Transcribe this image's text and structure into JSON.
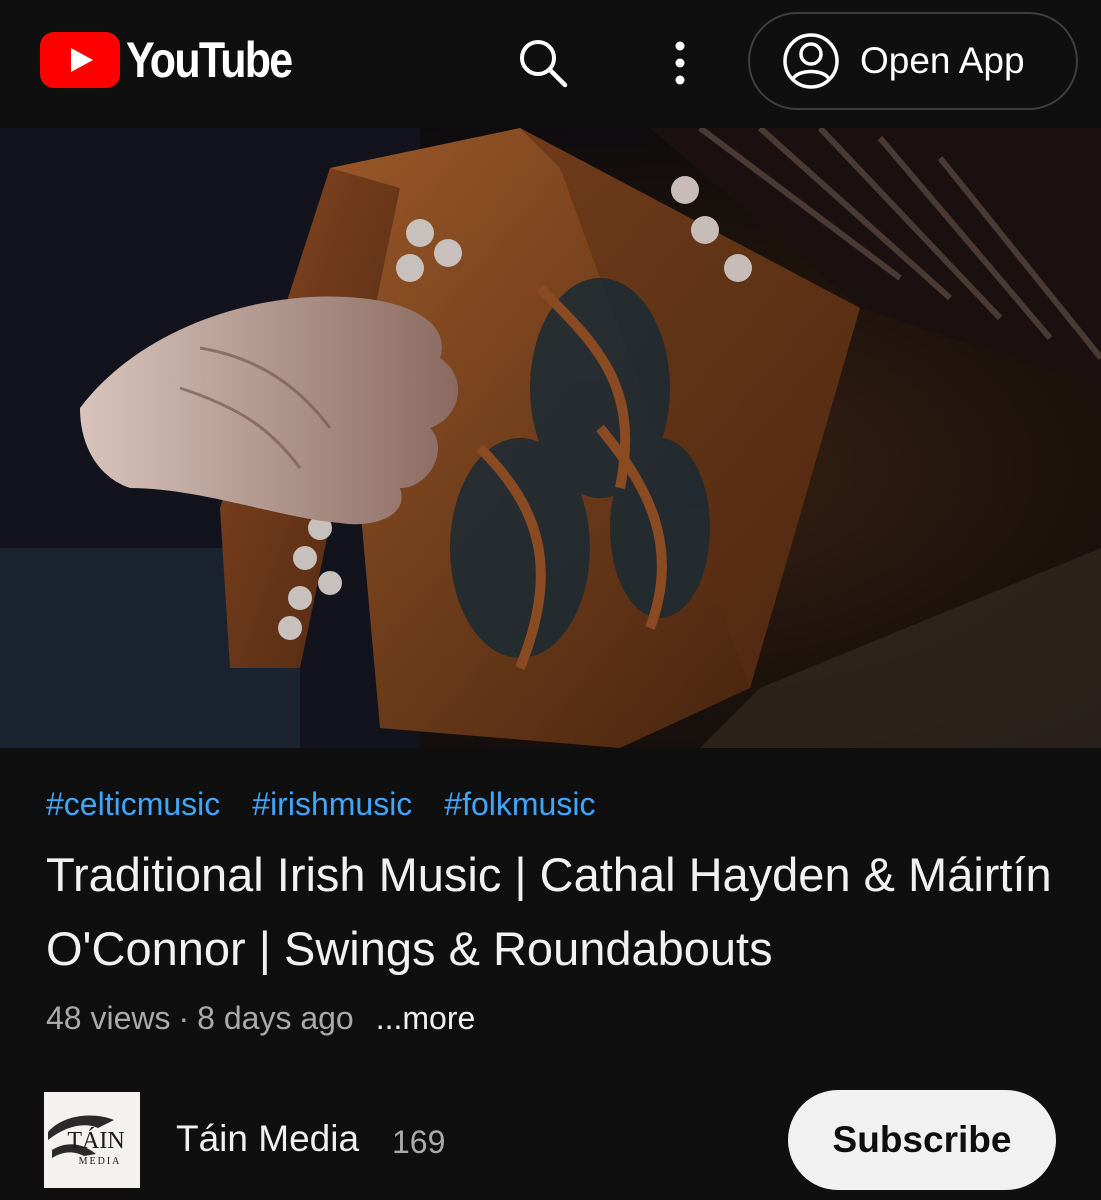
{
  "header": {
    "logo_text": "YouTube",
    "open_app_label": "Open App"
  },
  "video": {
    "hashtags": [
      "#celticmusic",
      "#irishmusic",
      "#folkmusic"
    ],
    "title": "Traditional Irish Music | Cathal Hayden & Máirtín O'Connor | Swings & Roundabouts",
    "views": "48 views",
    "separator": "·",
    "age": "8 days ago",
    "more_label": "...more"
  },
  "channel": {
    "name": "Táin Media",
    "subscriber_count": "169",
    "avatar_text": "TÁIN",
    "avatar_subtext": "MEDIA",
    "subscribe_label": "Subscribe"
  },
  "colors": {
    "background": "#0f0f0f",
    "brand_red": "#ff0000",
    "hashtag_blue": "#3ea6ff",
    "secondary_text": "#aaaaaa"
  },
  "icons": [
    "youtube-play-icon",
    "search-icon",
    "more-vertical-icon",
    "account-circle-icon"
  ]
}
